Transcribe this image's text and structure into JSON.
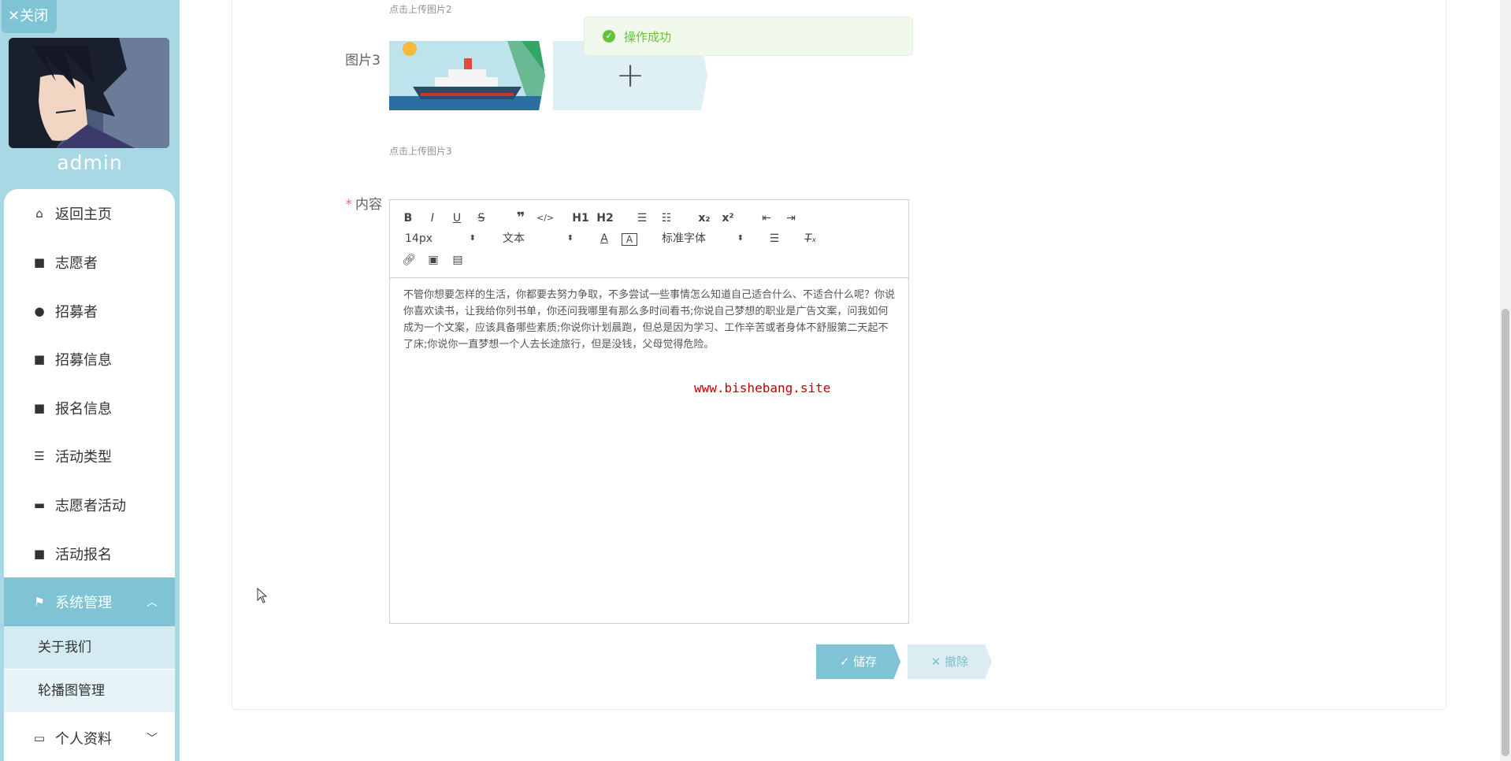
{
  "sidebar": {
    "close_label": "✕关闭",
    "username": "admin",
    "menu": [
      {
        "label": "返回主页",
        "icon": "home-icon"
      },
      {
        "label": "志愿者",
        "icon": "grid-icon"
      },
      {
        "label": "招募者",
        "icon": "user-icon"
      },
      {
        "label": "招募信息",
        "icon": "grid-icon"
      },
      {
        "label": "报名信息",
        "icon": "grid-icon"
      },
      {
        "label": "活动类型",
        "icon": "sliders-icon"
      },
      {
        "label": "志愿者活动",
        "icon": "briefcase-icon"
      },
      {
        "label": "活动报名",
        "icon": "grid-icon"
      },
      {
        "label": "系统管理",
        "icon": "flag-icon"
      },
      {
        "label": "个人资料",
        "icon": "card-icon"
      }
    ],
    "submenu": [
      {
        "label": "关于我们"
      },
      {
        "label": "轮播图管理"
      }
    ]
  },
  "form": {
    "hint_pic2": "点击上传图片2",
    "label_pic3": "图片3",
    "hint_pic3": "点击上传图片3",
    "label_content": "内容",
    "required_mark": "*"
  },
  "toast": {
    "message": "操作成功",
    "type": "success"
  },
  "editor": {
    "toolbar": {
      "font_size": "14px",
      "block_format": "文本",
      "font_family": "标准字体",
      "h1": "H1",
      "h2": "H2"
    },
    "content": "不管你想要怎样的生活，你都要去努力争取，不多尝试一些事情怎么知道自己适合什么、不适合什么呢？你说你喜欢读书，让我给你列书单，你还问我哪里有那么多时间看书;你说自己梦想的职业是广告文案，问我如何成为一个文案，应该具备哪些素质;你说你计划晨跑，但总是因为学习、工作辛苦或者身体不舒服第二天起不了床;你说你一直梦想一个人去长途旅行，但是没钱，父母觉得危险。",
    "watermark": "www.bishebang.site"
  },
  "buttons": {
    "save": "储存",
    "cancel": "撤除"
  },
  "colors": {
    "accent": "#7fc3d4",
    "sidebar_bg": "#a8d8e4",
    "success": "#67c23a"
  }
}
